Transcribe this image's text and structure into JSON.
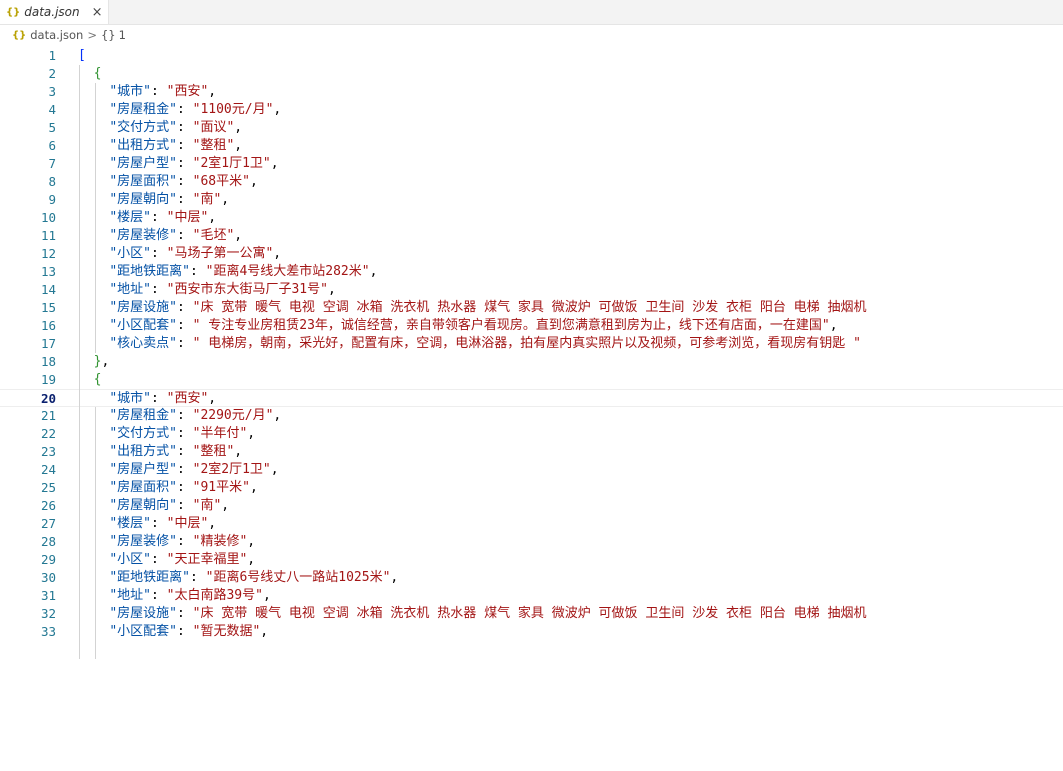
{
  "tab": {
    "icon": "{}",
    "name": "data.json",
    "close": "×"
  },
  "breadcrumb": {
    "icon": "{}",
    "file": "data.json",
    "separator": ">",
    "item_icon": "{}",
    "item": "1"
  },
  "colors": {
    "key": "#0451a5",
    "string": "#a31515",
    "line_number": "#237893",
    "bracket_outer": "#0431fa",
    "bracket_inner": "#319331"
  },
  "lines": [
    {
      "n": "1",
      "indent": 0,
      "bracket": "[",
      "btype": "outer"
    },
    {
      "n": "2",
      "indent": 1,
      "bracket": "{",
      "btype": "inner"
    },
    {
      "n": "3",
      "indent": 2,
      "key": "\"城市\"",
      "value": "\"西安\"",
      "comma": ","
    },
    {
      "n": "4",
      "indent": 2,
      "key": "\"房屋租金\"",
      "value": "\"1100元/月\"",
      "comma": ","
    },
    {
      "n": "5",
      "indent": 2,
      "key": "\"交付方式\"",
      "value": "\"面议\"",
      "comma": ","
    },
    {
      "n": "6",
      "indent": 2,
      "key": "\"出租方式\"",
      "value": "\"整租\"",
      "comma": ","
    },
    {
      "n": "7",
      "indent": 2,
      "key": "\"房屋户型\"",
      "value": "\"2室1厅1卫\"",
      "comma": ","
    },
    {
      "n": "8",
      "indent": 2,
      "key": "\"房屋面积\"",
      "value": "\"68平米\"",
      "comma": ","
    },
    {
      "n": "9",
      "indent": 2,
      "key": "\"房屋朝向\"",
      "value": "\"南\"",
      "comma": ","
    },
    {
      "n": "10",
      "indent": 2,
      "key": "\"楼层\"",
      "value": "\"中层\"",
      "comma": ","
    },
    {
      "n": "11",
      "indent": 2,
      "key": "\"房屋装修\"",
      "value": "\"毛坯\"",
      "comma": ","
    },
    {
      "n": "12",
      "indent": 2,
      "key": "\"小区\"",
      "value": "\"马场子第一公寓\"",
      "comma": ","
    },
    {
      "n": "13",
      "indent": 2,
      "key": "\"距地铁距离\"",
      "value": "\"距离4号线大差市站282米\"",
      "comma": ","
    },
    {
      "n": "14",
      "indent": 2,
      "key": "\"地址\"",
      "value": "\"西安市东大街马厂子31号\"",
      "comma": ","
    },
    {
      "n": "15",
      "indent": 2,
      "key": "\"房屋设施\"",
      "value": "\"床 宽带 暖气 电视 空调 冰箱 洗衣机 热水器 煤气 家具 微波炉 可做饭 卫生间 沙发 衣柜 阳台 电梯 抽烟机",
      "comma": ""
    },
    {
      "n": "16",
      "indent": 2,
      "key": "\"小区配套\"",
      "value": "\" 专注专业房租赁23年，诚信经营，亲自带领客户看现房。直到您满意租到房为止，线下还有店面，一在建国\"",
      "comma": ","
    },
    {
      "n": "17",
      "indent": 2,
      "key": "\"核心卖点\"",
      "value": "\" 电梯房，朝南，采光好，配置有床，空调，电淋浴器，拍有屋内真实照片以及视频，可参考浏览，看现房有钥匙 \"",
      "comma": ""
    },
    {
      "n": "18",
      "indent": 1,
      "bracket": "}",
      "btype": "inner",
      "comma": ","
    },
    {
      "n": "19",
      "indent": 1,
      "bracket": "{",
      "btype": "inner"
    },
    {
      "n": "20",
      "indent": 2,
      "key": "\"城市\"",
      "value": "\"西安\"",
      "comma": ",",
      "current": true
    },
    {
      "n": "21",
      "indent": 2,
      "key": "\"房屋租金\"",
      "value": "\"2290元/月\"",
      "comma": ","
    },
    {
      "n": "22",
      "indent": 2,
      "key": "\"交付方式\"",
      "value": "\"半年付\"",
      "comma": ","
    },
    {
      "n": "23",
      "indent": 2,
      "key": "\"出租方式\"",
      "value": "\"整租\"",
      "comma": ","
    },
    {
      "n": "24",
      "indent": 2,
      "key": "\"房屋户型\"",
      "value": "\"2室2厅1卫\"",
      "comma": ","
    },
    {
      "n": "25",
      "indent": 2,
      "key": "\"房屋面积\"",
      "value": "\"91平米\"",
      "comma": ","
    },
    {
      "n": "26",
      "indent": 2,
      "key": "\"房屋朝向\"",
      "value": "\"南\"",
      "comma": ","
    },
    {
      "n": "27",
      "indent": 2,
      "key": "\"楼层\"",
      "value": "\"中层\"",
      "comma": ","
    },
    {
      "n": "28",
      "indent": 2,
      "key": "\"房屋装修\"",
      "value": "\"精装修\"",
      "comma": ","
    },
    {
      "n": "29",
      "indent": 2,
      "key": "\"小区\"",
      "value": "\"天正幸福里\"",
      "comma": ","
    },
    {
      "n": "30",
      "indent": 2,
      "key": "\"距地铁距离\"",
      "value": "\"距离6号线丈八一路站1025米\"",
      "comma": ","
    },
    {
      "n": "31",
      "indent": 2,
      "key": "\"地址\"",
      "value": "\"太白南路39号\"",
      "comma": ","
    },
    {
      "n": "32",
      "indent": 2,
      "key": "\"房屋设施\"",
      "value": "\"床 宽带 暖气 电视 空调 冰箱 洗衣机 热水器 煤气 家具 微波炉 可做饭 卫生间 沙发 衣柜 阳台 电梯 抽烟机",
      "comma": ""
    },
    {
      "n": "33",
      "indent": 2,
      "key": "\"小区配套\"",
      "value": "\"暂无数据\"",
      "comma": ","
    }
  ]
}
